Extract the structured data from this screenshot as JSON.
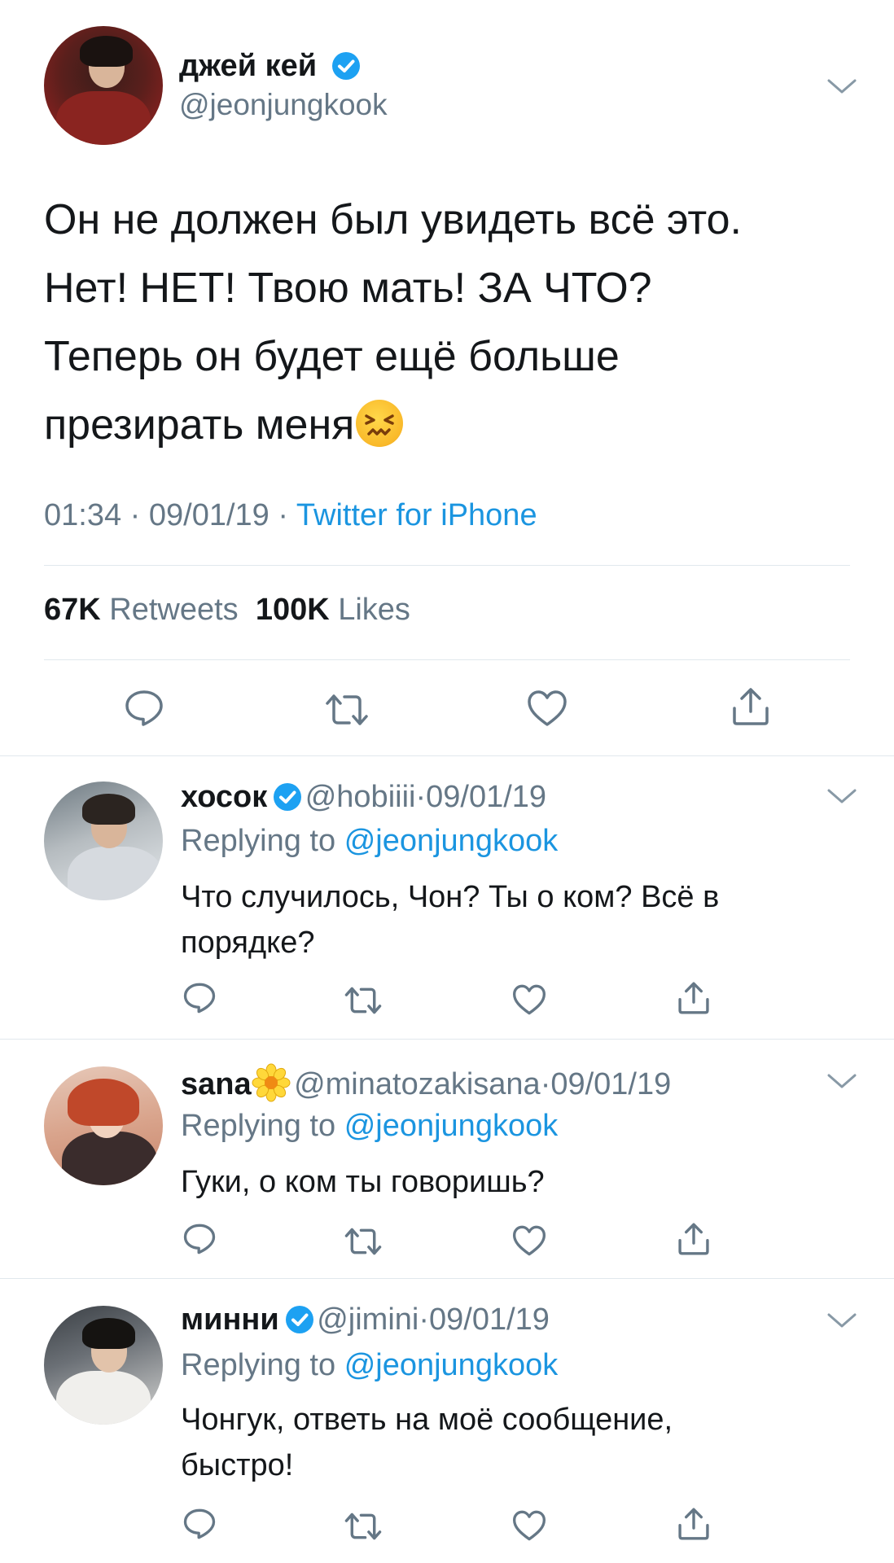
{
  "main_tweet": {
    "display_name": "джей кей",
    "handle": "@jeonjungkook",
    "text_lines": [
      "Он не должен был увидеть всё это.",
      "Нет! НЕТ! Твою мать! ЗА ЧТО?",
      "Теперь он будет ещё больше",
      "презирать меня"
    ],
    "emoji": "confounded-face",
    "time": "01:34",
    "date": "09/01/19",
    "separator": "·",
    "source": "Twitter for iPhone",
    "retweets_count": "67K",
    "retweets_label": "Retweets",
    "likes_count": "100K",
    "likes_label": "Likes"
  },
  "replies": [
    {
      "display_name": "хосок",
      "verified": true,
      "handle": "@hobiiii",
      "date": "09/01/19",
      "replying_prefix": "Replying to",
      "replying_to": "@jeonjungkook",
      "text_lines": [
        "Что случилось, Чон? Ты о ком? Всё в",
        "порядке?"
      ]
    },
    {
      "display_name": "sana",
      "verified": false,
      "name_emoji": "flower",
      "handle": "@minatozakisana",
      "date": "09/01/19",
      "replying_prefix": "Replying to",
      "replying_to": "@jeonjungkook",
      "text_lines": [
        "Гуки, о ком ты говоришь?"
      ]
    },
    {
      "display_name": "минни",
      "verified": true,
      "handle": "@jimini",
      "date": "09/01/19",
      "replying_prefix": "Replying to",
      "replying_to": "@jeonjungkook",
      "text_lines": [
        "Чонгук, ответь на моё сообщение,",
        "быстро!"
      ]
    }
  ],
  "icons": [
    "reply-icon",
    "retweet-icon",
    "like-icon",
    "share-icon",
    "chevron-down-icon",
    "verified-badge-icon"
  ],
  "colors": {
    "accent": "#1da1f2",
    "link": "#1b95e0",
    "secondary_text": "#657786",
    "primary_text": "#14171a",
    "divider": "#e1e8ed"
  }
}
